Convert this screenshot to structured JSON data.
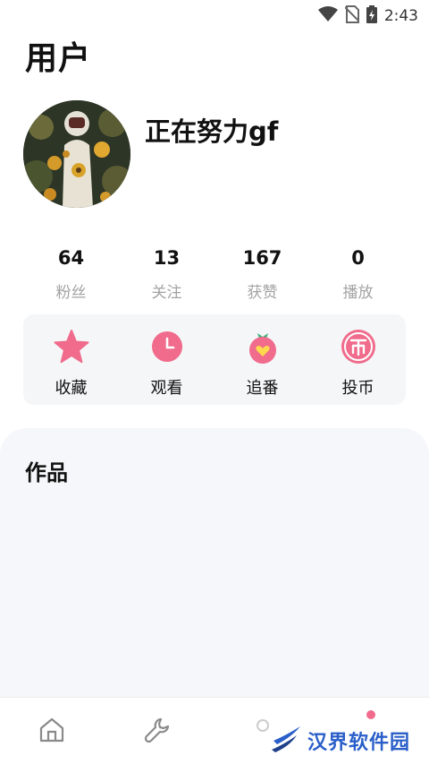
{
  "status_bar": {
    "time": "2:43",
    "icons": [
      "wifi-icon",
      "no-sim-icon",
      "battery-icon"
    ]
  },
  "page": {
    "title": "用户"
  },
  "profile": {
    "username": "正在努力gf",
    "avatar": "avatar-image"
  },
  "stats": [
    {
      "value": "64",
      "label": "粉丝"
    },
    {
      "value": "13",
      "label": "关注"
    },
    {
      "value": "167",
      "label": "获赞"
    },
    {
      "value": "0",
      "label": "播放"
    }
  ],
  "actions": [
    {
      "label": "收藏",
      "icon": "star-icon"
    },
    {
      "label": "观看",
      "icon": "clock-icon"
    },
    {
      "label": "追番",
      "icon": "strawberry-heart-icon"
    },
    {
      "label": "投币",
      "icon": "coin-icon"
    }
  ],
  "works": {
    "title": "作品"
  },
  "bottom_nav": {
    "items": [
      "home-icon",
      "wrench-icon",
      "user-icon"
    ]
  },
  "watermark": {
    "text": "汉界软件园"
  },
  "colors": {
    "accent_pink": "#f06b8c",
    "action_bg": "#f5f6f8",
    "works_bg": "#f6f7fa",
    "watermark_blue": "#2a5fc9"
  }
}
